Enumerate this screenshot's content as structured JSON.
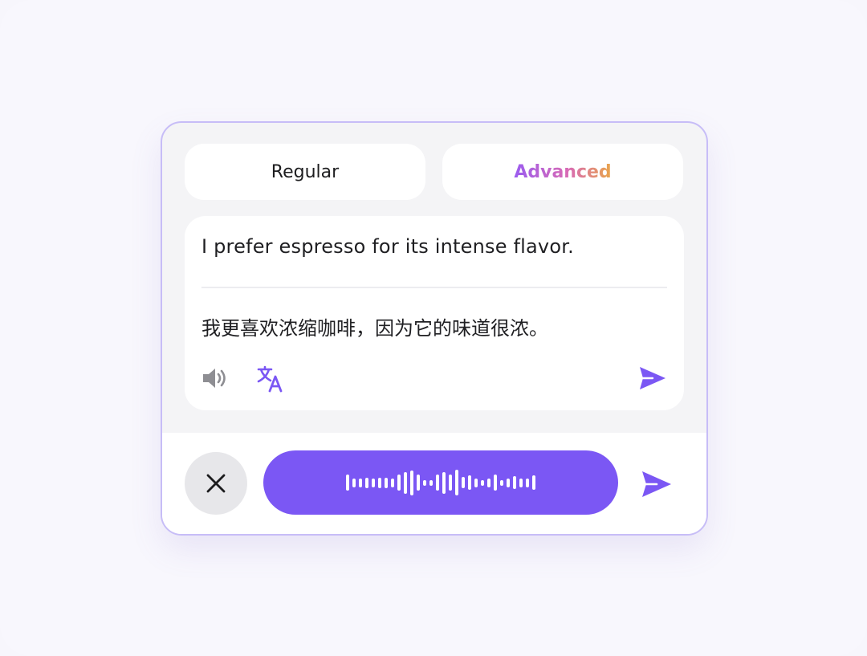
{
  "modes": {
    "regular_label": "Regular",
    "advanced_label": "Advanced"
  },
  "translation": {
    "source_text": "I prefer espresso for its intense flavor.",
    "target_text": "我更喜欢浓缩咖啡，因为它的味道很浓。"
  },
  "icons": {
    "speaker": "speaker-icon",
    "translate": "translate-icon",
    "send": "send-icon",
    "close": "close-icon",
    "waveform": "waveform-icon"
  },
  "recording": {
    "waveform_levels": [
      0.55,
      0.3,
      0.3,
      0.35,
      0.3,
      0.35,
      0.35,
      0.3,
      0.55,
      0.75,
      0.85,
      0.55,
      0.2,
      0.2,
      0.55,
      0.75,
      0.55,
      0.9,
      0.4,
      0.5,
      0.3,
      0.2,
      0.3,
      0.55,
      0.2,
      0.3,
      0.45,
      0.3,
      0.3,
      0.5
    ]
  },
  "colors": {
    "accent": "#7b57f4",
    "card_border": "#c7bdf7",
    "advanced_gradient_start": "#9b5cf0",
    "advanced_gradient_end": "#e9a64a",
    "speaker_gray": "#8e8e93"
  }
}
